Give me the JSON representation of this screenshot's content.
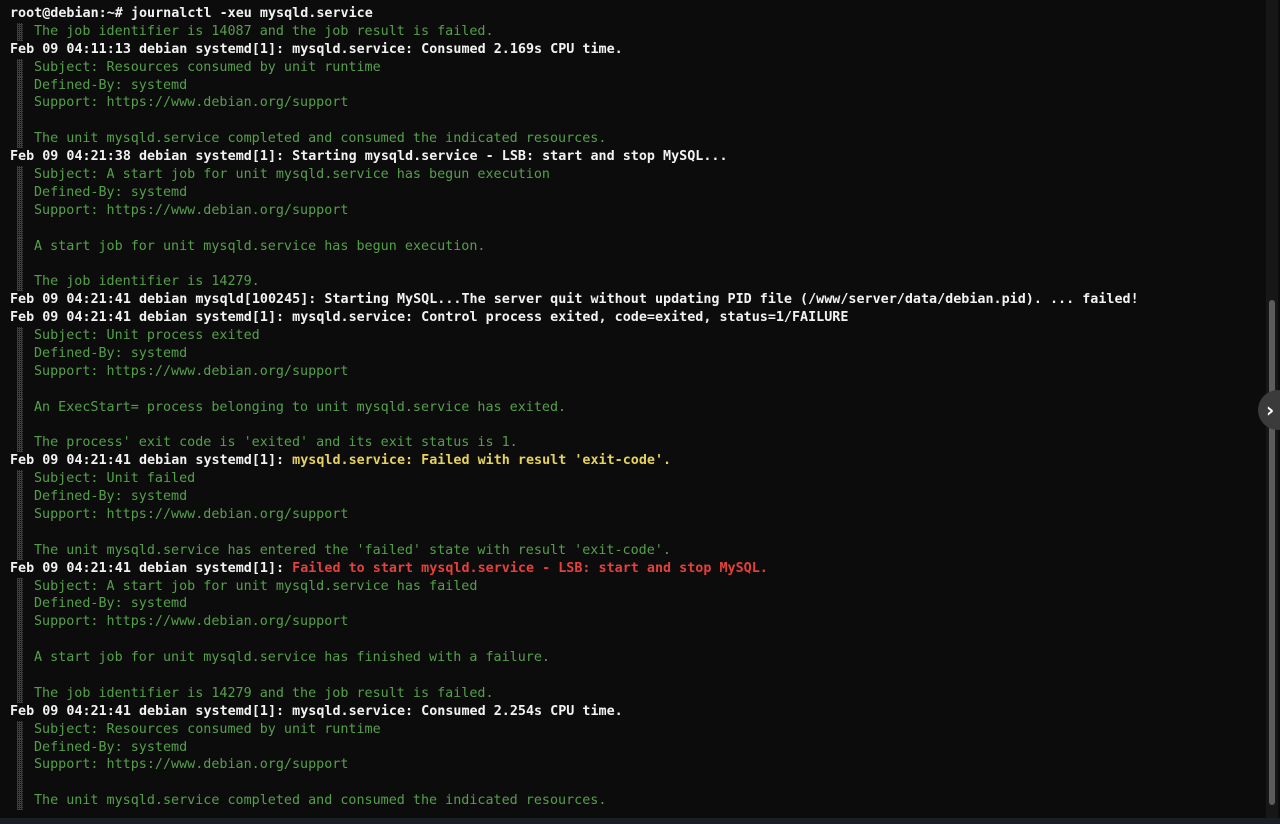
{
  "terminal": {
    "lines": [
      {
        "type": "prompt",
        "text": "root@debian:~# journalctl -xeu mysqld.service"
      },
      {
        "type": "cont",
        "text": "The job identifier is 14087 and the job result is failed."
      },
      {
        "type": "bold",
        "text": "Feb 09 04:11:13 debian systemd[1]: mysqld.service: Consumed 2.169s CPU time."
      },
      {
        "type": "cont",
        "text": "Subject: Resources consumed by unit runtime"
      },
      {
        "type": "cont",
        "text": "Defined-By: systemd"
      },
      {
        "type": "cont",
        "text": "Support: https://www.debian.org/support"
      },
      {
        "type": "cont",
        "text": ""
      },
      {
        "type": "cont",
        "text": "The unit mysqld.service completed and consumed the indicated resources."
      },
      {
        "type": "bold",
        "text": "Feb 09 04:21:38 debian systemd[1]: Starting mysqld.service - LSB: start and stop MySQL..."
      },
      {
        "type": "cont",
        "text": "Subject: A start job for unit mysqld.service has begun execution"
      },
      {
        "type": "cont",
        "text": "Defined-By: systemd"
      },
      {
        "type": "cont",
        "text": "Support: https://www.debian.org/support"
      },
      {
        "type": "cont",
        "text": ""
      },
      {
        "type": "cont",
        "text": "A start job for unit mysqld.service has begun execution."
      },
      {
        "type": "cont",
        "text": ""
      },
      {
        "type": "cont",
        "text": "The job identifier is 14279."
      },
      {
        "type": "bold",
        "text": "Feb 09 04:21:41 debian mysqld[100245]: Starting MySQL...The server quit without updating PID file (/www/server/data/debian.pid). ... failed!"
      },
      {
        "type": "bold",
        "text": "Feb 09 04:21:41 debian systemd[1]: mysqld.service: Control process exited, code=exited, status=1/FAILURE"
      },
      {
        "type": "cont",
        "text": "Subject: Unit process exited"
      },
      {
        "type": "cont",
        "text": "Defined-By: systemd"
      },
      {
        "type": "cont",
        "text": "Support: https://www.debian.org/support"
      },
      {
        "type": "cont",
        "text": ""
      },
      {
        "type": "cont",
        "text": "An ExecStart= process belonging to unit mysqld.service has exited."
      },
      {
        "type": "cont",
        "text": ""
      },
      {
        "type": "cont",
        "text": "The process' exit code is 'exited' and its exit status is 1."
      },
      {
        "type": "bold",
        "prefix": "Feb 09 04:21:41 debian systemd[1]: ",
        "highlight": "mysqld.service: Failed with result 'exit-code'.",
        "highlight_color": "yellow"
      },
      {
        "type": "cont",
        "text": "Subject: Unit failed"
      },
      {
        "type": "cont",
        "text": "Defined-By: systemd"
      },
      {
        "type": "cont",
        "text": "Support: https://www.debian.org/support"
      },
      {
        "type": "cont",
        "text": ""
      },
      {
        "type": "cont",
        "text": "The unit mysqld.service has entered the 'failed' state with result 'exit-code'."
      },
      {
        "type": "bold",
        "prefix": "Feb 09 04:21:41 debian systemd[1]: ",
        "highlight": "Failed to start mysqld.service - LSB: start and stop MySQL.",
        "highlight_color": "red"
      },
      {
        "type": "cont",
        "text": "Subject: A start job for unit mysqld.service has failed"
      },
      {
        "type": "cont",
        "text": "Defined-By: systemd"
      },
      {
        "type": "cont",
        "text": "Support: https://www.debian.org/support"
      },
      {
        "type": "cont",
        "text": ""
      },
      {
        "type": "cont",
        "text": "A start job for unit mysqld.service has finished with a failure."
      },
      {
        "type": "cont",
        "text": ""
      },
      {
        "type": "cont",
        "text": "The job identifier is 14279 and the job result is failed."
      },
      {
        "type": "bold",
        "text": "Feb 09 04:21:41 debian systemd[1]: mysqld.service: Consumed 2.254s CPU time."
      },
      {
        "type": "cont",
        "text": "Subject: Resources consumed by unit runtime"
      },
      {
        "type": "cont",
        "text": "Defined-By: systemd"
      },
      {
        "type": "cont",
        "text": "Support: https://www.debian.org/support"
      },
      {
        "type": "cont",
        "text": ""
      },
      {
        "type": "cont",
        "text": "The unit mysqld.service completed and consumed the indicated resources."
      }
    ]
  },
  "colors": {
    "background": "#0c0c0c",
    "text_bold": "#f2f2f2",
    "text_green": "#54a04a",
    "highlight_yellow": "#e6d35b",
    "highlight_red": "#e5413c"
  },
  "next_button": {
    "icon": "chevron-right-icon",
    "glyph": "›"
  }
}
